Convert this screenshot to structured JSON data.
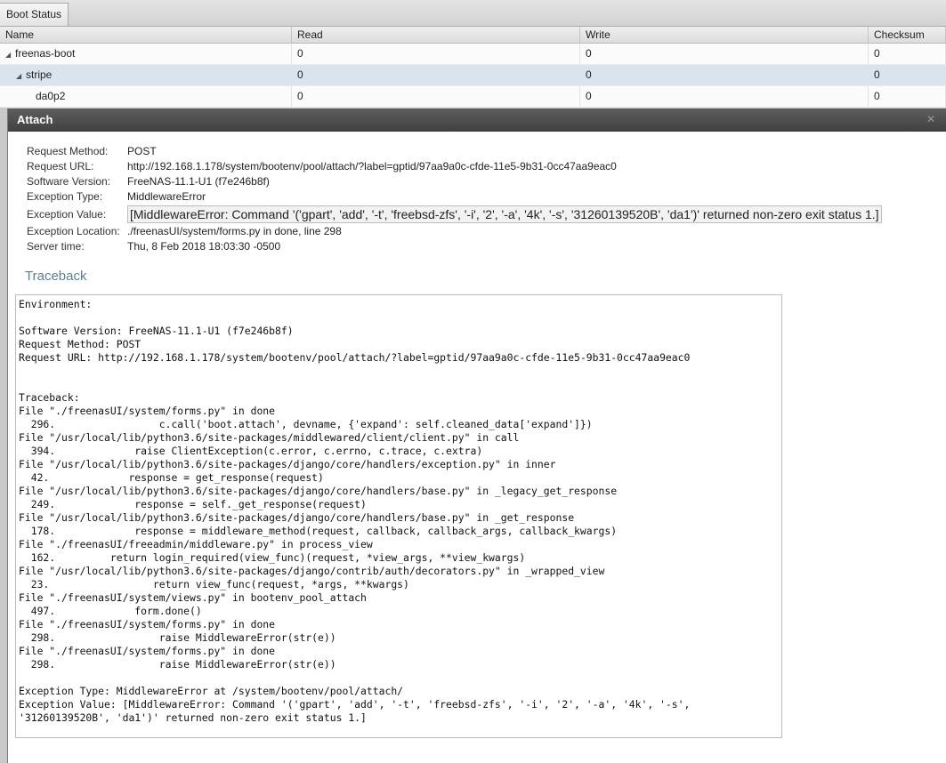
{
  "tab": {
    "label": "Boot Status"
  },
  "grid": {
    "columns": [
      "Name",
      "Read",
      "Write",
      "Checksum"
    ],
    "rows": [
      {
        "name": "freenas-boot",
        "read": "0",
        "write": "0",
        "checksum": "0"
      },
      {
        "name": "stripe",
        "read": "0",
        "write": "0",
        "checksum": "0"
      },
      {
        "name": "da0p2",
        "read": "0",
        "write": "0",
        "checksum": "0"
      }
    ]
  },
  "dialog": {
    "title": "Attach",
    "meta": [
      {
        "label": "Request Method:",
        "value": "POST"
      },
      {
        "label": "Request URL:",
        "value": "http://192.168.1.178/system/bootenv/pool/attach/?label=gptid/97aa9a0c-cfde-11e5-9b31-0cc47aa9eac0"
      },
      {
        "label": "Software Version:",
        "value": "FreeNAS-11.1-U1 (f7e246b8f)"
      },
      {
        "label": "Exception Type:",
        "value": "MiddlewareError"
      },
      {
        "label": "Exception Value:",
        "value": "[MiddlewareError: Command '('gpart', 'add', '-t', 'freebsd-zfs', '-i', '2', '-a', '4k', '-s', '31260139520B', 'da1')' returned non-zero exit status 1.]"
      },
      {
        "label": "Exception Location:",
        "value": "./freenasUI/system/forms.py in done, line 298"
      },
      {
        "label": "Server time:",
        "value": "Thu, 8 Feb 2018 18:03:30 -0500"
      }
    ],
    "traceback_title": "Traceback",
    "traceback_text": "Environment:\n\nSoftware Version: FreeNAS-11.1-U1 (f7e246b8f)\nRequest Method: POST\nRequest URL: http://192.168.1.178/system/bootenv/pool/attach/?label=gptid/97aa9a0c-cfde-11e5-9b31-0cc47aa9eac0\n\n\nTraceback:\nFile \"./freenasUI/system/forms.py\" in done\n  296.                 c.call('boot.attach', devname, {'expand': self.cleaned_data['expand']})\nFile \"/usr/local/lib/python3.6/site-packages/middlewared/client/client.py\" in call\n  394.             raise ClientException(c.error, c.errno, c.trace, c.extra)\nFile \"/usr/local/lib/python3.6/site-packages/django/core/handlers/exception.py\" in inner\n  42.             response = get_response(request)\nFile \"/usr/local/lib/python3.6/site-packages/django/core/handlers/base.py\" in _legacy_get_response\n  249.             response = self._get_response(request)\nFile \"/usr/local/lib/python3.6/site-packages/django/core/handlers/base.py\" in _get_response\n  178.             response = middleware_method(request, callback, callback_args, callback_kwargs)\nFile \"./freenasUI/freeadmin/middleware.py\" in process_view\n  162.         return login_required(view_func)(request, *view_args, **view_kwargs)\nFile \"/usr/local/lib/python3.6/site-packages/django/contrib/auth/decorators.py\" in _wrapped_view\n  23.                 return view_func(request, *args, **kwargs)\nFile \"./freenasUI/system/views.py\" in bootenv_pool_attach\n  497.             form.done()\nFile \"./freenasUI/system/forms.py\" in done\n  298.                 raise MiddlewareError(str(e))\nFile \"./freenasUI/system/forms.py\" in done\n  298.                 raise MiddlewareError(str(e))\n\nException Type: MiddlewareError at /system/bootenv/pool/attach/\nException Value: [MiddlewareError: Command '('gpart', 'add', '-t', 'freebsd-zfs', '-i', '2', '-a', '4k', '-s',\n'31260139520B', 'da1')' returned non-zero exit status 1.]"
  }
}
